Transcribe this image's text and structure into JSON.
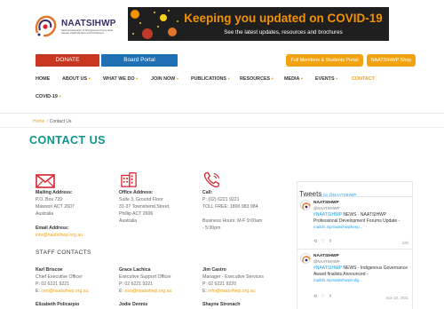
{
  "header": {
    "logo_name": "NAATSIHWP",
    "logo_subtitle": "National Association of Aboriginal and Torres Strait Islander Health Workers and Practitioners",
    "banner_title": "Keeping you updated on COVID-19",
    "banner_subtitle": "See the latest updates, resources and brochures"
  },
  "buttons": {
    "donate": "DONATE",
    "board_portal": "Board Portal",
    "members_portal": "Full Members & Students Portal",
    "shop": "NAATSIHWP Shop"
  },
  "nav": {
    "items": [
      {
        "label": "HOME",
        "caret": ""
      },
      {
        "label": "ABOUT US",
        "caret": "▾"
      },
      {
        "label": "WHAT WE DO",
        "caret": "▾"
      },
      {
        "label": "JOIN NOW",
        "caret": "▾"
      },
      {
        "label": "PUBLICATIONS",
        "caret": "▾"
      },
      {
        "label": "RESOURCES",
        "caret": "▾"
      },
      {
        "label": "MEDIA",
        "caret": "▾"
      },
      {
        "label": "EVENTS",
        "caret": "▾"
      },
      {
        "label": "CONTACT",
        "caret": ""
      },
      {
        "label": "COVID-19",
        "caret": "▾"
      }
    ]
  },
  "breadcrumb": {
    "home": "Home",
    "separator": "/",
    "current": "Contact Us"
  },
  "page_title": "CONTACT US",
  "mailing": {
    "label": "Mailing Address:",
    "lines": [
      "P.O. Box 729",
      "Mawson ACT 2607",
      "Australia"
    ],
    "email_label": "Email Address:",
    "email": "info@naatsihwp.org.au"
  },
  "office": {
    "label": "Office Address:",
    "lines": [
      "Suite 3, Ground Floor",
      "31-37 Townshend Street,",
      "Phillip ACT 2606",
      "Australia"
    ]
  },
  "call": {
    "label": "Call:",
    "lines": [
      "P: (02) 6221 9221",
      "TOLL FREE: 1800 983 984"
    ],
    "hours_lines": [
      "Business Hours: M-F 9:00am",
      "- 5:00pm"
    ]
  },
  "staff": {
    "heading": "STAFF CONTACTS",
    "people": [
      {
        "name": "Karl Briscoe",
        "role": "Chief Executive Officer",
        "phone": "P: 02 6221 9221",
        "email_prefix": "E:",
        "email": "ceo@naatsihwp.org.au"
      },
      {
        "name": "Grace Lachica",
        "role": "Executive Support Officer",
        "phone": "P: 02 6221 9221",
        "email_prefix": "E:",
        "email": "eso@naatsihwp.org.au"
      },
      {
        "name": "Jim Castro",
        "role": "Manager - Executive Services",
        "phone": "P: 02 6221 9220",
        "email_prefix": "E:",
        "email": "info@naatsihwp.org.au"
      }
    ],
    "next_row": [
      "Elizabeth Policarpio",
      "Jodie Dennis",
      "Shayne Stronach"
    ]
  },
  "tweets": {
    "title": "Tweets",
    "by": "by @NAATSIHWP",
    "items": [
      {
        "name": "NAATSIHWP",
        "handle": "@NAATSIHWP",
        "hashtag": "#NAATSIHWP",
        "text_line1": " NEWS - NAATSIHWP",
        "text_line2": "Professional Development Forums Update -",
        "link": "mailchi.mp/naatsihwp/keep...",
        "date": "23h"
      },
      {
        "name": "NAATSIHWP",
        "handle": "@NAATSIHWP",
        "hashtag": "#NAATSIHWP",
        "text_line1": " NEWS - Indigenous Governance",
        "text_line2": "Award finalists Announced -",
        "link": "mailchi.mp/naatsihwp/indig...",
        "date": "Nov 10, 2021"
      }
    ]
  },
  "colors": {
    "teal": "#0f9488",
    "orange": "#f2a312",
    "donate_red": "#c8371f",
    "portal_blue": "#1f6fb5",
    "twitter_blue": "#1da1f2"
  }
}
